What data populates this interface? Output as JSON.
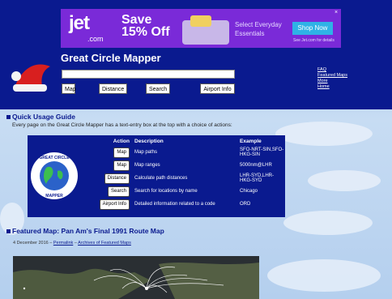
{
  "ad": {
    "brand": "jet",
    "brand_sub": ".com",
    "headline_line1": "Save",
    "headline_line2": "15% Off",
    "tagline_line1": "Select Everyday",
    "tagline_line2": "Essentials",
    "cta": "Shop Now",
    "fine_print": "See Jet.com for details",
    "close": "×"
  },
  "header": {
    "title": "Great Circle Mapper",
    "search_value": "",
    "buttons": [
      "Map",
      "Distance",
      "Search",
      "Airport Info"
    ],
    "links": [
      "FAQ",
      "Featured Maps",
      "More",
      "Home"
    ]
  },
  "guide": {
    "heading": "Quick Usage Guide",
    "intro": "Every page on the Great Circle Mapper has a text-entry box at the top with a choice of actions:",
    "columns": [
      "Action",
      "Description",
      "Example"
    ],
    "rows": [
      {
        "action": "Map",
        "description": "Map paths",
        "example": "SFO-NRT-SIN,SFO-HKG-SIN"
      },
      {
        "action": "Map",
        "description": "Map ranges",
        "example": "5000nm@LHR"
      },
      {
        "action": "Distance",
        "description": "Calculate path distances",
        "example": "LHR-SYD,LHR-HKG-SYD"
      },
      {
        "action": "Search",
        "description": "Search for locations by name",
        "example": "Chicago"
      },
      {
        "action": "Airport Info",
        "description": "Detailed information related to a code",
        "example": "ORD"
      }
    ]
  },
  "featured": {
    "heading": "Featured Map: Pan Am's Final 1991 Route Map",
    "date": "4 December 2016",
    "sep1": " – ",
    "permalink": "Permalink",
    "sep2": " – ",
    "archives": "Archives of Featured Maps"
  },
  "colors": {
    "header_bg": "#0a1a8f",
    "ad_bg": "#7a2ad8",
    "cta_bg": "#2fb2e6"
  }
}
